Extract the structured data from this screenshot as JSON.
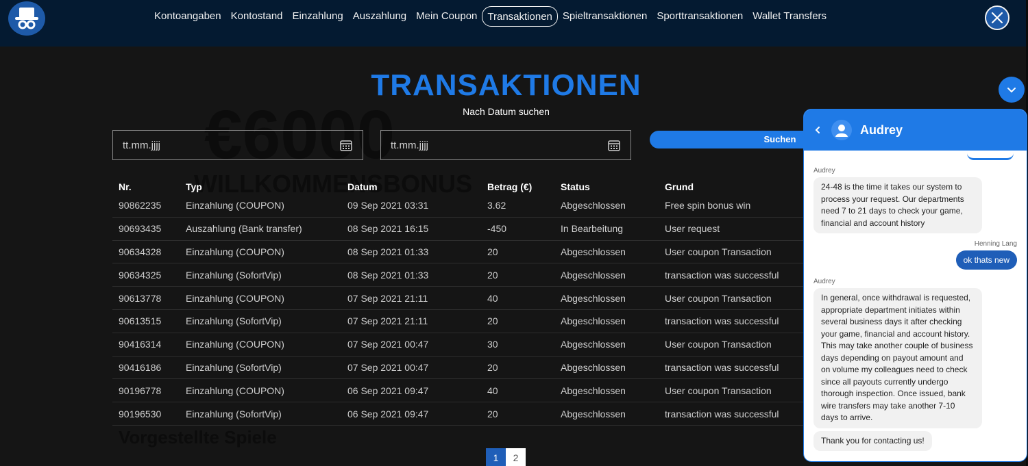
{
  "nav": {
    "items": [
      {
        "label": "Kontoangaben",
        "active": false
      },
      {
        "label": "Kontostand",
        "active": false
      },
      {
        "label": "Einzahlung",
        "active": false
      },
      {
        "label": "Auszahlung",
        "active": false
      },
      {
        "label": "Mein Coupon",
        "active": false
      },
      {
        "label": "Transaktionen",
        "active": true
      },
      {
        "label": "Spieltransaktionen",
        "active": false
      },
      {
        "label": "Sporttransaktionen",
        "active": false
      },
      {
        "label": "Wallet Transfers",
        "active": false
      }
    ]
  },
  "background": {
    "amount": "€6000",
    "welcome": "WILLKOMMENSBONUS",
    "games": "Vorgestellte Spiele"
  },
  "main": {
    "title": "TRANSAKTIONEN",
    "subtitle": "Nach Datum suchen",
    "date_from_placeholder": "tt.mm.jjjj",
    "date_to_placeholder": "tt.mm.jjjj",
    "search_label": "Suchen"
  },
  "table": {
    "headers": {
      "nr": "Nr.",
      "typ": "Typ",
      "datum": "Datum",
      "betrag": "Betrag (€)",
      "status": "Status",
      "grund": "Grund"
    },
    "rows": [
      {
        "nr": "90862235",
        "typ": "Einzahlung  (COUPON)",
        "datum": "09 Sep 2021 03:31",
        "betrag": "3.62",
        "status": "Abgeschlossen",
        "grund": "Free spin bonus win"
      },
      {
        "nr": "90693435",
        "typ": "Auszahlung  (Bank transfer)",
        "datum": "08 Sep 2021 16:15",
        "betrag": "-450",
        "status": "In Bearbeitung",
        "grund": "User request"
      },
      {
        "nr": "90634328",
        "typ": "Einzahlung  (COUPON)",
        "datum": "08 Sep 2021 01:33",
        "betrag": "20",
        "status": "Abgeschlossen",
        "grund": "User coupon Transaction"
      },
      {
        "nr": "90634325",
        "typ": "Einzahlung  (SofortVip)",
        "datum": "08 Sep 2021 01:33",
        "betrag": "20",
        "status": "Abgeschlossen",
        "grund": "transaction was successful"
      },
      {
        "nr": "90613778",
        "typ": "Einzahlung  (COUPON)",
        "datum": "07 Sep 2021 21:11",
        "betrag": "40",
        "status": "Abgeschlossen",
        "grund": "User coupon Transaction"
      },
      {
        "nr": "90613515",
        "typ": "Einzahlung  (SofortVip)",
        "datum": "07 Sep 2021 21:11",
        "betrag": "20",
        "status": "Abgeschlossen",
        "grund": "transaction was successful"
      },
      {
        "nr": "90416314",
        "typ": "Einzahlung  (COUPON)",
        "datum": "07 Sep 2021 00:47",
        "betrag": "30",
        "status": "Abgeschlossen",
        "grund": "User coupon Transaction"
      },
      {
        "nr": "90416186",
        "typ": "Einzahlung  (SofortVip)",
        "datum": "07 Sep 2021 00:47",
        "betrag": "20",
        "status": "Abgeschlossen",
        "grund": "transaction was successful"
      },
      {
        "nr": "90196778",
        "typ": "Einzahlung  (COUPON)",
        "datum": "06 Sep 2021 09:47",
        "betrag": "40",
        "status": "Abgeschlossen",
        "grund": "User coupon Transaction"
      },
      {
        "nr": "90196530",
        "typ": "Einzahlung  (SofortVip)",
        "datum": "06 Sep 2021 09:47",
        "betrag": "20",
        "status": "Abgeschlossen",
        "grund": "transaction was successful"
      }
    ]
  },
  "pagination": {
    "pages": [
      "1",
      "2"
    ],
    "current": "1"
  },
  "chat": {
    "agent_name": "Audrey",
    "messages": [
      {
        "from": "agent",
        "sender": "Audrey",
        "text": "24-48 is the time it takes our system to process your request. Our departments need 7 to 21 days to check your game, financial and account history"
      },
      {
        "from": "user",
        "sender": "Henning Lang",
        "text": "ok thats new"
      },
      {
        "from": "agent",
        "sender": "Audrey",
        "text": "In general, once withdrawal is requested, appropriate department initiates within several business days it after checking your game, financial and account history. This may take another couple of business days depending on payout amount and on volume my colleagues need to check since all payouts currently undergo thorough inspection. Once issued, bank wire transfers may take another 7-10 days to arrive."
      },
      {
        "from": "agent",
        "sender": "",
        "text": "Thank you for contacting us!"
      }
    ]
  },
  "colors": {
    "accent": "#1f7ae6",
    "nav_bg": "#041a31",
    "page_bg": "#151515"
  },
  "icons": {
    "logo": "top-hat-logo-icon",
    "close": "close-icon",
    "calendar": "calendar-icon",
    "chat_toggle": "chevron-down-icon",
    "chat_back": "chevron-left-icon",
    "avatar": "user-avatar-icon"
  }
}
